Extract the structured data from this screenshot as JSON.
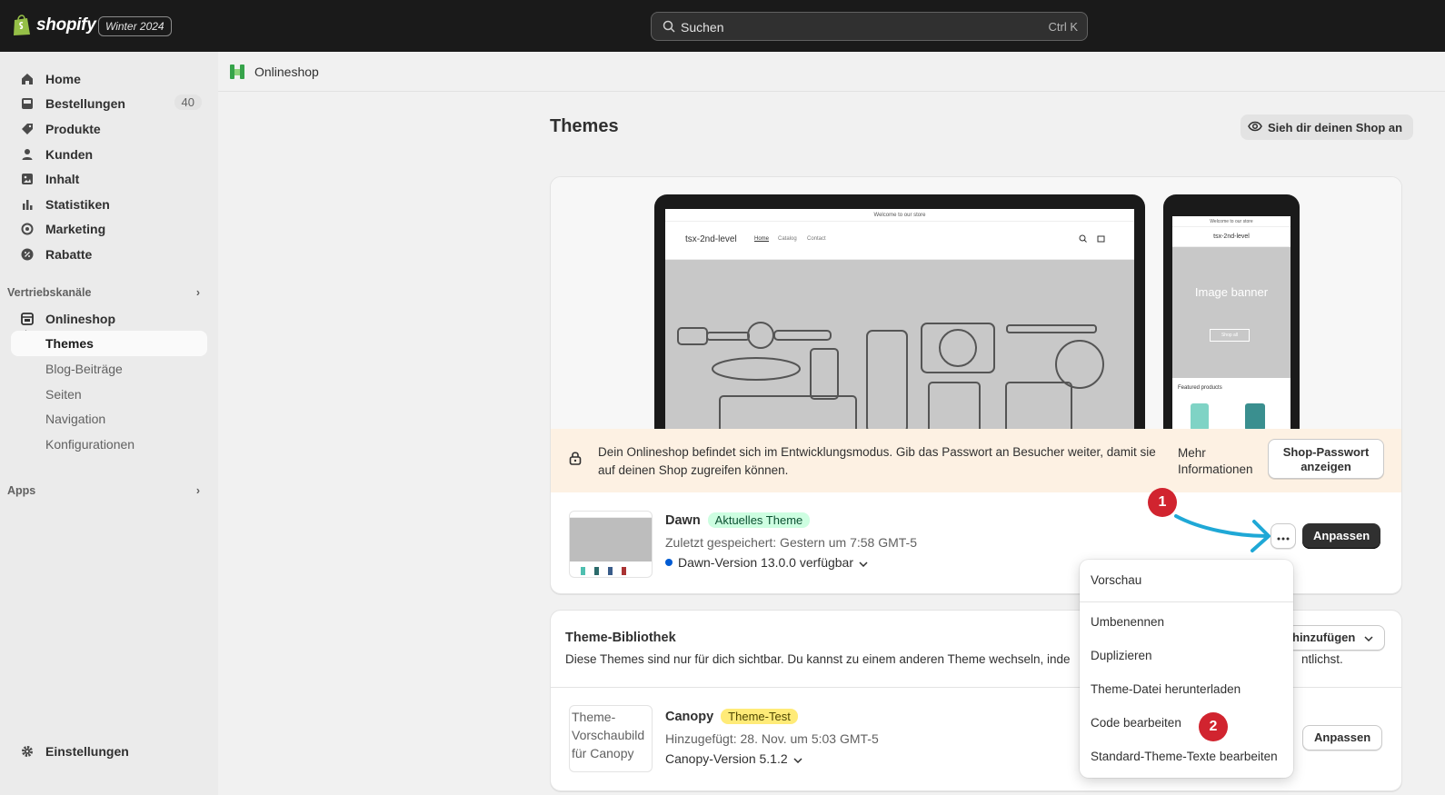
{
  "topbar": {
    "brand": "shopify",
    "edition": "Winter 2024",
    "search_placeholder": "Suchen",
    "search_shortcut": "Ctrl K"
  },
  "sidebar": {
    "items": [
      {
        "label": "Home",
        "icon": "home-icon"
      },
      {
        "label": "Bestellungen",
        "icon": "inbox-icon",
        "count": "40"
      },
      {
        "label": "Produkte",
        "icon": "tag-icon"
      },
      {
        "label": "Kunden",
        "icon": "person-icon"
      },
      {
        "label": "Inhalt",
        "icon": "image-icon"
      },
      {
        "label": "Statistiken",
        "icon": "bar-chart-icon"
      },
      {
        "label": "Marketing",
        "icon": "target-icon"
      },
      {
        "label": "Rabatte",
        "icon": "discount-icon"
      }
    ],
    "sales_channels_heading": "Vertriebskanäle",
    "channel": {
      "label": "Onlineshop",
      "icon": "store-icon"
    },
    "sub_items": [
      "Themes",
      "Blog-Beiträge",
      "Seiten",
      "Navigation",
      "Konfigurationen"
    ],
    "apps_heading": "Apps",
    "settings_label": "Einstellungen"
  },
  "breadcrumb": {
    "label": "Onlineshop"
  },
  "page": {
    "title": "Themes",
    "view_shop_label": "Sieh dir deinen Shop an"
  },
  "preview": {
    "announcement": "Welcome to our store",
    "store_name": "tsx-2nd-level",
    "nav": [
      "Home",
      "Catalog",
      "Contact"
    ],
    "phone_banner_title": "Image banner",
    "phone_shop_all": "Shop all",
    "phone_featured": "Featured products"
  },
  "notice": {
    "text": "Dein Onlineshop befindet sich im Entwicklungsmodus. Gib das Passwort an Besucher weiter, damit sie auf deinen Shop zugreifen können.",
    "more_info": "Mehr Informationen",
    "password_button": "Shop-Passwort anzeigen"
  },
  "current_theme": {
    "name": "Dawn",
    "badge": "Aktuelles Theme",
    "saved": "Zuletzt gespeichert: Gestern um 7:58 GMT-5",
    "version": "Dawn-Version 13.0.0 verfügbar",
    "customize": "Anpassen"
  },
  "library": {
    "title": "Theme-Bibliothek",
    "description": "Diese Themes sind nur für dich sichtbar. Du kannst zu einem anderen Theme wechseln, inde",
    "description_tail": "ntlichst.",
    "add_button": "hinzufügen"
  },
  "library_theme": {
    "name": "Canopy",
    "badge": "Theme-Test",
    "thumb_alt": "Theme-Vorschaubild für Canopy",
    "added": "Hinzugefügt: 28. Nov. um 5:03 GMT-5",
    "version": "Canopy-Version 5.1.2",
    "customize": "Anpassen"
  },
  "menu": {
    "items": [
      "Vorschau",
      "Umbenennen",
      "Duplizieren",
      "Theme-Datei herunterladen",
      "Code bearbeiten",
      "Standard-Theme-Texte bearbeiten"
    ]
  },
  "annotations": {
    "step1": "1",
    "step2": "2",
    "arrow_color": "#1fa8d6",
    "step_color": "#d1242f"
  }
}
